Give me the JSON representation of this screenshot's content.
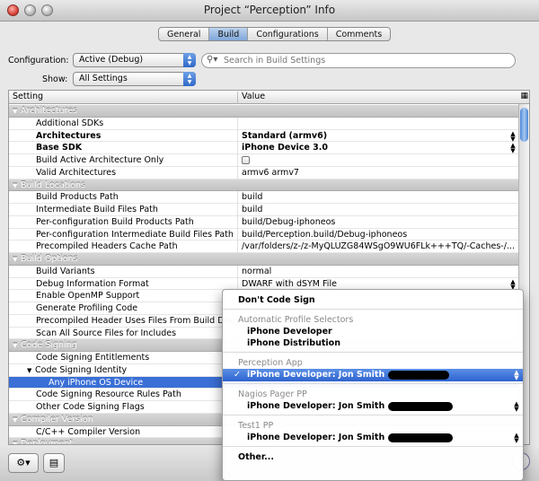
{
  "window": {
    "title": "Project “Perception” Info"
  },
  "tabs": [
    {
      "label": "General",
      "active": false
    },
    {
      "label": "Build",
      "active": true
    },
    {
      "label": "Configurations",
      "active": false
    },
    {
      "label": "Comments",
      "active": false
    }
  ],
  "configuration": {
    "label": "Configuration:",
    "value": "Active (Debug)"
  },
  "show": {
    "label": "Show:",
    "value": "All Settings"
  },
  "search": {
    "placeholder": "Search in Build Settings",
    "icon": "magnifier-icon"
  },
  "table": {
    "headers": {
      "setting": "Setting",
      "value": "Value"
    },
    "rows": [
      {
        "type": "group",
        "name": "Architectures"
      },
      {
        "type": "item",
        "name": "Additional SDKs",
        "value": ""
      },
      {
        "type": "item",
        "name": "Architectures",
        "value": "Standard (armv6)",
        "bold": true,
        "stepper": true
      },
      {
        "type": "item",
        "name": "Base SDK",
        "value": "iPhone Device 3.0",
        "bold": true,
        "stepper": true
      },
      {
        "type": "item",
        "name": "Build Active Architecture Only",
        "value": "",
        "checkbox": true
      },
      {
        "type": "item",
        "name": "Valid Architectures",
        "value": "armv6 armv7"
      },
      {
        "type": "group",
        "name": "Build Locations"
      },
      {
        "type": "item",
        "name": "Build Products Path",
        "value": "build"
      },
      {
        "type": "item",
        "name": "Intermediate Build Files Path",
        "value": "build"
      },
      {
        "type": "item",
        "name": "Per-configuration Build Products Path",
        "value": "build/Debug-iphoneos"
      },
      {
        "type": "item",
        "name": "Per-configuration Intermediate Build Files Path",
        "value": "build/Perception.build/Debug-iphoneos"
      },
      {
        "type": "item",
        "name": "Precompiled Headers Cache Path",
        "value": "/var/folders/z-/z-MyQLUZG84WSgO9WU6FLk+++TQ/-Caches-/..."
      },
      {
        "type": "group",
        "name": "Build Options"
      },
      {
        "type": "item",
        "name": "Build Variants",
        "value": "normal"
      },
      {
        "type": "item",
        "name": "Debug Information Format",
        "value": "DWARF with dSYM File",
        "stepper": true
      },
      {
        "type": "item",
        "name": "Enable OpenMP Support",
        "value": "",
        "checkbox": true
      },
      {
        "type": "item",
        "name": "Generate Profiling Code",
        "value": ""
      },
      {
        "type": "item",
        "name": "Precompiled Header Uses Files From Build Directory",
        "value": ""
      },
      {
        "type": "item",
        "name": "Scan All Source Files for Includes",
        "value": ""
      },
      {
        "type": "group",
        "name": "Code Signing"
      },
      {
        "type": "item",
        "name": "Code Signing Entitlements",
        "value": ""
      },
      {
        "type": "item",
        "name": "Code Signing Identity",
        "value": "",
        "expander": true
      },
      {
        "type": "sub",
        "name": "Any iPhone OS Device",
        "value": "",
        "selected": true
      },
      {
        "type": "item",
        "name": "Code Signing Resource Rules Path",
        "value": ""
      },
      {
        "type": "item",
        "name": "Other Code Signing Flags",
        "value": ""
      },
      {
        "type": "group",
        "name": "Compiler Version"
      },
      {
        "type": "item",
        "name": "C/C++ Compiler Version",
        "value": ""
      },
      {
        "type": "group",
        "name": "Deployment"
      }
    ]
  },
  "menu": {
    "items": [
      {
        "kind": "top",
        "label": "Don't Code Sign"
      },
      {
        "kind": "sep"
      },
      {
        "kind": "header",
        "label": "Automatic Profile Selectors"
      },
      {
        "kind": "item",
        "label": "iPhone Developer"
      },
      {
        "kind": "item",
        "label": "iPhone Distribution"
      },
      {
        "kind": "sep"
      },
      {
        "kind": "header",
        "label": "Perception App"
      },
      {
        "kind": "item",
        "label": "iPhone Developer: Jon Smith",
        "selected": true,
        "redacted": true
      },
      {
        "kind": "sep"
      },
      {
        "kind": "header",
        "label": "Nagios Pager PP"
      },
      {
        "kind": "item",
        "label": "iPhone Developer: Jon Smith",
        "redacted": true
      },
      {
        "kind": "sep"
      },
      {
        "kind": "header",
        "label": "Test1 PP"
      },
      {
        "kind": "item",
        "label": "iPhone Developer: Jon Smith",
        "redacted": true
      },
      {
        "kind": "sep"
      },
      {
        "kind": "top",
        "label": "Other..."
      }
    ],
    "checkmark": "✓"
  },
  "bottom": {
    "action_icon": "gear-icon",
    "action_arrow": "▾",
    "help_label": "?",
    "info_icon": "list-icon"
  },
  "colors": {
    "selection": "#3a6fd6",
    "accent": "#2e63cf"
  }
}
